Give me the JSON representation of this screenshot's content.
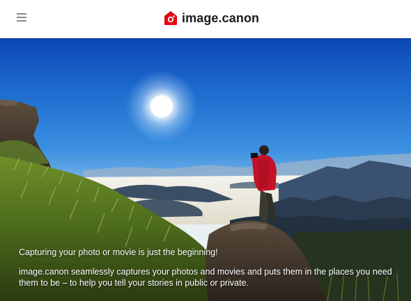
{
  "header": {
    "menu_icon": "hamburger-menu-icon",
    "logo_icon": "camera-house-icon",
    "logo_text": "image.canon",
    "brand_color": "#e60012"
  },
  "hero": {
    "headline": "Capturing your photo or movie is just the beginning!",
    "description": "image.canon seamlessly captures your photos and movies and puts them in the places you need them to be – to help you tell your stories in public or private."
  }
}
